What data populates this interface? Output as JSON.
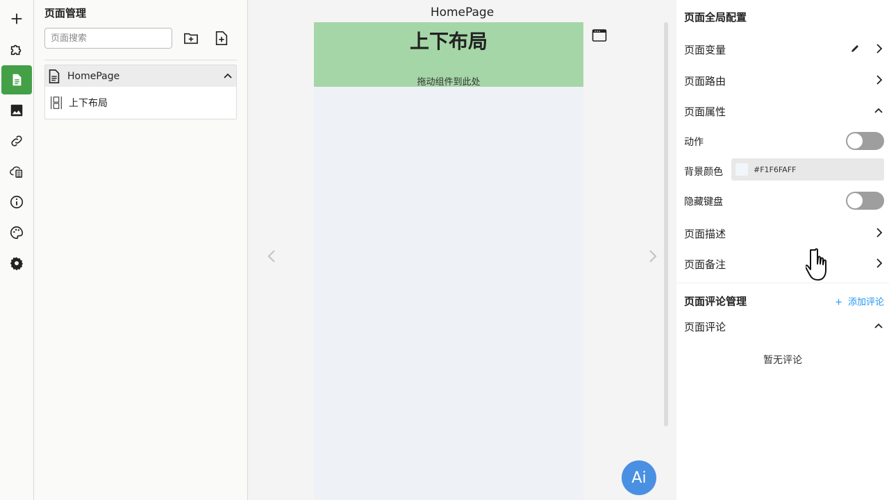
{
  "sidebar": {
    "items": [
      {
        "icon": "plus-icon"
      },
      {
        "icon": "puzzle-icon"
      },
      {
        "icon": "page-icon",
        "active": true
      },
      {
        "icon": "image-icon"
      },
      {
        "icon": "link-icon"
      },
      {
        "icon": "cloud-data-icon"
      },
      {
        "icon": "info-icon"
      },
      {
        "icon": "palette-icon"
      },
      {
        "icon": "gear-icon"
      }
    ],
    "active_color": "#43a047"
  },
  "page_manager": {
    "title": "页面管理",
    "search_placeholder": "页面搜索",
    "tree": {
      "page_label": "HomePage",
      "child_label": "上下布局"
    }
  },
  "canvas": {
    "title": "HomePage",
    "layout_title": "上下布局",
    "drop_hint": "拖动组件到此处",
    "ai_label": "Ai",
    "layout_color": "#a5d6a7"
  },
  "config": {
    "title": "页面全局配置",
    "page_variables": "页面变量",
    "page_route": "页面路由",
    "page_properties": "页面属性",
    "action_label": "动作",
    "bg_color_label": "背景颜色",
    "bg_color_value": "#F1F6FAFF",
    "hide_keyboard_label": "隐藏键盘",
    "page_description": "页面描述",
    "page_notes": "页面备注",
    "comments_title": "页面评论管理",
    "add_comment": "添加评论",
    "page_comments": "页面评论",
    "no_comments": "暂无评论"
  }
}
